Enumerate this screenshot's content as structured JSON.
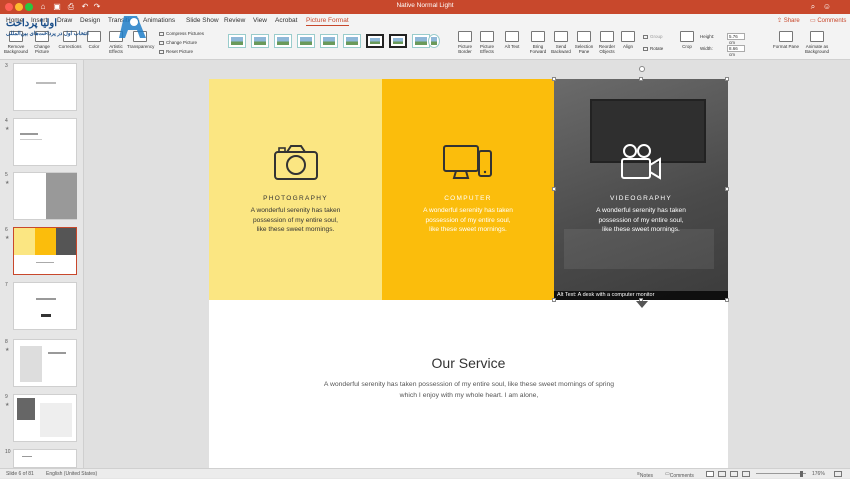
{
  "window": {
    "title": "Native Normal Light"
  },
  "brand": {
    "accent": "#c8482c",
    "yellow_light": "#fbe682",
    "yellow": "#fbbd0c",
    "dark": "#555555"
  },
  "watermark": {
    "tagline": "انتخاب اول در پرداخت‌های بین‌المللی"
  },
  "tabs": [
    {
      "label": "Home"
    },
    {
      "label": "Insert"
    },
    {
      "label": "Draw"
    },
    {
      "label": "Design"
    },
    {
      "label": "Transitions"
    },
    {
      "label": "Animations"
    },
    {
      "label": "Slide Show"
    },
    {
      "label": "Review"
    },
    {
      "label": "View"
    },
    {
      "label": "Acrobat"
    },
    {
      "label": "Picture Format"
    }
  ],
  "toolbar": {
    "share": "Share",
    "comments": "Comments"
  },
  "ribbon": {
    "remove_bg": "Remove Background",
    "change_picture": "Change Picture",
    "corrections": "Corrections",
    "color": "Color",
    "artistic": "Artistic Effects",
    "transparency": "Transparency",
    "compress": "Compress Pictures",
    "change_picture_small": "Change Picture",
    "reset_picture": "Reset Picture",
    "picture_border": "Picture Border",
    "picture_effects": "Picture Effects",
    "alt_text": "Alt Text",
    "bring_forward": "Bring Forward",
    "send_backward": "Send Backward",
    "selection_pane": "Selection Pane",
    "reorder": "Reorder Objects",
    "align": "Align",
    "group": "Group",
    "rotate": "Rotate",
    "crop": "Crop",
    "height_label": "Height:",
    "height_value": "5.76 cm",
    "width_label": "Width:",
    "width_value": "8.66 cm",
    "format_pane": "Format Pane",
    "animate_bg": "Animate as Background"
  },
  "sidebar": {
    "slides": [
      {
        "num": "3"
      },
      {
        "num": "4"
      },
      {
        "num": "5"
      },
      {
        "num": "6"
      },
      {
        "num": "7"
      },
      {
        "num": "8"
      },
      {
        "num": "9"
      },
      {
        "num": "10"
      }
    ]
  },
  "slide": {
    "panels": [
      {
        "title": "PHOTOGRAPHY",
        "desc": "A wonderful serenity has taken possession of my entire soul, like these sweet mornings."
      },
      {
        "title": "COMPUTER",
        "desc": "A wonderful serenity has taken possession of my entire soul, like these sweet mornings."
      },
      {
        "title": "VIDEOGRAPHY",
        "desc": "A wonderful serenity has taken possession of my entire soul, like these sweet mornings."
      }
    ],
    "alt_text": "Alt Text: A desk with a computer monitor",
    "service_title": "Our Service",
    "service_desc": "A wonderful serenity has taken possession of my entire soul, like these sweet mornings of spring which I enjoy with my whole heart. I am alone,"
  },
  "status": {
    "slide_of": "Slide 6 of 81",
    "language": "English (United States)",
    "notes": "Notes",
    "comments": "Comments",
    "zoom": "176%"
  }
}
